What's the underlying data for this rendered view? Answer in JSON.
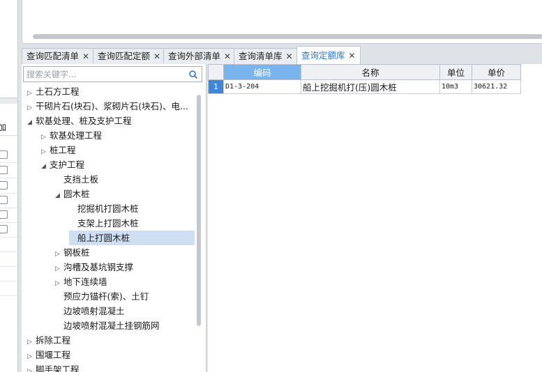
{
  "left_panel": {
    "header_text": "加",
    "checkbox_rows": 6,
    "empty_rows": 3
  },
  "tabs": [
    {
      "label": "查询匹配清单",
      "close": "✕"
    },
    {
      "label": "查询匹配定额",
      "close": "✕"
    },
    {
      "label": "查询外部清单",
      "close": "✕"
    },
    {
      "label": "查询清单库",
      "close": "✕"
    },
    {
      "label": "查询定额库",
      "close": "✕",
      "active": true
    }
  ],
  "search": {
    "placeholder": "搜索关键字...",
    "value": ""
  },
  "tree": [
    {
      "label": "土石方工程",
      "arrow": "▷",
      "level": 0
    },
    {
      "label": "干砌片石(块石)、浆砌片石(块石)、电...",
      "arrow": "▷",
      "level": 0
    },
    {
      "label": "软基处理、桩及支护工程",
      "arrow": "◢",
      "level": 0
    },
    {
      "label": "软基处理工程",
      "arrow": "▷",
      "level": 1
    },
    {
      "label": "桩工程",
      "arrow": "▷",
      "level": 1
    },
    {
      "label": "支护工程",
      "arrow": "◢",
      "level": 1
    },
    {
      "label": "支挡土板",
      "arrow": "",
      "level": 2
    },
    {
      "label": "圆木桩",
      "arrow": "◢",
      "level": 2
    },
    {
      "label": "挖掘机打圆木桩",
      "arrow": "",
      "level": 3
    },
    {
      "label": "支架上打圆木桩",
      "arrow": "",
      "level": 3
    },
    {
      "label": "船上打圆木桩",
      "arrow": "",
      "level": 3,
      "selected": true
    },
    {
      "label": "钢板桩",
      "arrow": "▷",
      "level": 2
    },
    {
      "label": "沟槽及基坑钢支撑",
      "arrow": "▷",
      "level": 2
    },
    {
      "label": "地下连续墙",
      "arrow": "▷",
      "level": 2
    },
    {
      "label": "预应力锚杆(索)、土钉",
      "arrow": "",
      "level": 2
    },
    {
      "label": "边坡喷射混凝土",
      "arrow": "",
      "level": 2
    },
    {
      "label": "边坡喷射混凝土挂钢筋网",
      "arrow": "",
      "level": 2
    },
    {
      "label": "拆除工程",
      "arrow": "▷",
      "level": 0
    },
    {
      "label": "围堰工程",
      "arrow": "▷",
      "level": 0
    },
    {
      "label": "脚手架工程",
      "arrow": "▷",
      "level": 0
    }
  ],
  "grid": {
    "headers": {
      "code": "编码",
      "name": "名称",
      "unit": "单位",
      "price": "单价"
    },
    "rows": [
      {
        "num": "1",
        "code": "D1-3-204",
        "name": "船上挖掘机打(压)圆木桩",
        "unit": "10m3",
        "price": "30621.32"
      }
    ]
  },
  "colors": {
    "accent": "#2b78d0",
    "header_highlight": "#7ab4ee",
    "rownum": "#3d86d8",
    "selection": "#cfdff3"
  }
}
